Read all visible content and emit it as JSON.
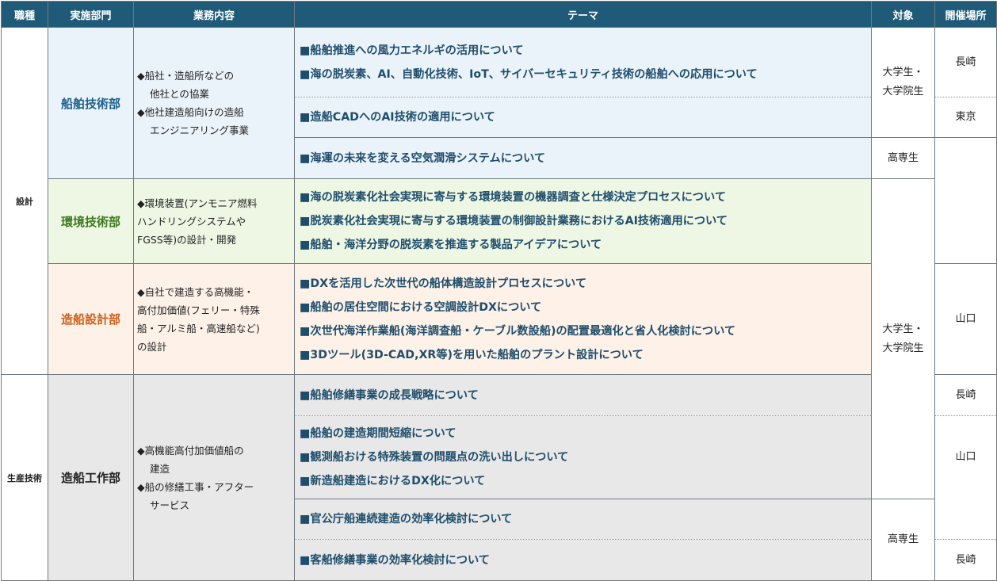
{
  "headers": {
    "job": "職種",
    "dept": "実施部門",
    "work": "業務内容",
    "theme": "テーマ",
    "target": "対象",
    "place": "開催場所"
  },
  "jobs": {
    "design": "設計",
    "production": "生産技術"
  },
  "departments": {
    "ship_tech": {
      "name": "船舶技術部",
      "color": "#1f5f8b",
      "desc": [
        "◆船社・造船所などの",
        "他社との協業",
        "◆他社建造船向けの造船",
        "エンジニアリング事業"
      ]
    },
    "env_tech": {
      "name": "環境技術部",
      "color": "#3d7a1f",
      "desc": [
        "◆環境装置(アンモニア燃料",
        "ハンドリングシステムや",
        "FGSS等)の設計・開発"
      ]
    },
    "ship_design": {
      "name": "造船設計部",
      "color": "#d0601a",
      "desc": [
        "◆自社で建造する高機能・",
        "高付加価値(フェリー・特殊",
        "船・アルミ船・高速船など)",
        "の設計"
      ]
    },
    "ship_works": {
      "name": "造船工作部",
      "color": "#222222",
      "desc": [
        "◆高機能高付加価値船の",
        "建造",
        "◆船の修繕工事・アフター",
        "サービス"
      ]
    }
  },
  "themes": {
    "g1": [
      "■船舶推進への風力エネルギの活用について",
      "■海の脱炭素、AI、自動化技術、IoT、サイバーセキュリティ技術の船舶への応用について"
    ],
    "g2": [
      "■造船CADへのAI技術の適用について"
    ],
    "g3": [
      "■海運の未来を変える空気潤滑システムについて"
    ],
    "g4": [
      "■海の脱炭素化社会実現に寄与する環境装置の機器調査と仕様決定プロセスについて",
      "■脱炭素化社会実現に寄与する環境装置の制御設計業務におけるAI技術適用について",
      "■船舶・海洋分野の脱炭素を推進する製品アイデアについて"
    ],
    "g5": [
      "■DXを活用した次世代の船体構造設計プロセスについて",
      "■船舶の居住空間における空調設計DXについて",
      "■次世代海洋作業船(海洋調査船・ケーブル数設船)の配置最適化と省人化検討について",
      "■3Dツール(3D-CAD,XR等)を用いた船舶のプラント設計について"
    ],
    "g6": [
      "■船舶修繕事業の成長戦略について"
    ],
    "g7": [
      "■船舶の建造期間短縮について",
      "■観測船おける特殊装置の問題点の洗い出しについて",
      "■新造船建造におけるDX化について"
    ],
    "g8": [
      "■官公庁船連続建造の効率化検討について"
    ],
    "g9": [
      "■客船修繕事業の効率化検討について"
    ]
  },
  "targets": {
    "univ": [
      "大学生・",
      "大学院生"
    ],
    "kosen": "高専生"
  },
  "places": {
    "nagasaki": "長崎",
    "tokyo": "東京",
    "yamaguchi": "山口"
  }
}
